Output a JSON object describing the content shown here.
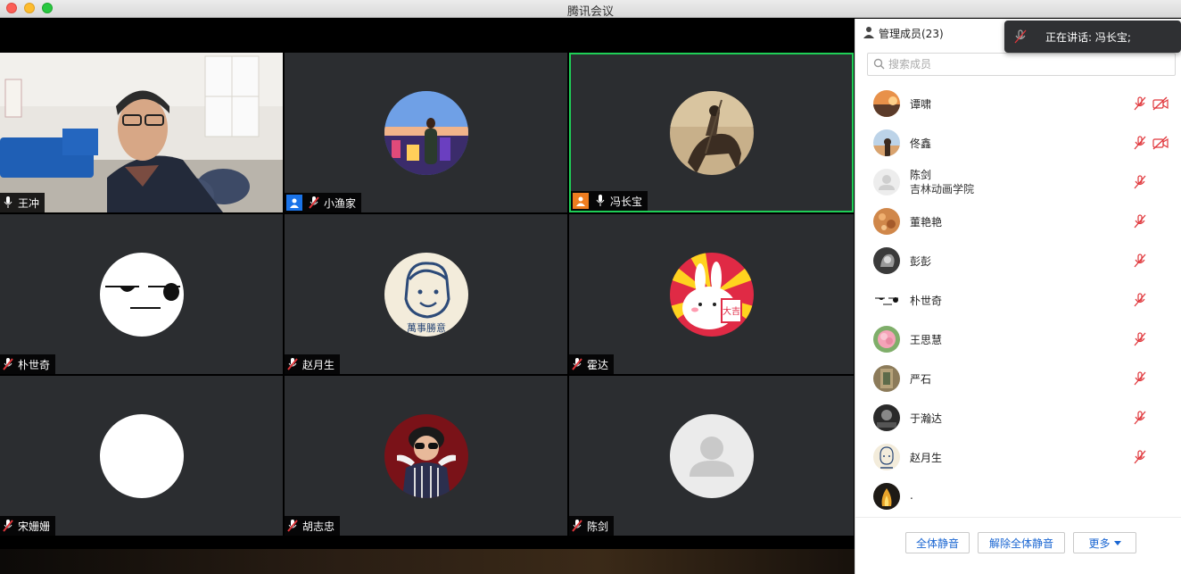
{
  "window": {
    "title": "腾讯会议"
  },
  "tiles": [
    {
      "name": "王冲",
      "mic": "on",
      "host": null,
      "active": false,
      "avatar": "video-feed"
    },
    {
      "name": "小渔家",
      "mic": "muted",
      "host": "blue",
      "active": false,
      "avatar": "city-night-photo"
    },
    {
      "name": "冯长宝",
      "mic": "on",
      "host": "orange",
      "active": true,
      "avatar": "knight-on-horse"
    },
    {
      "name": "朴世奇",
      "mic": "muted",
      "host": null,
      "active": false,
      "avatar": "meh-face"
    },
    {
      "name": "赵月生",
      "mic": "muted",
      "host": null,
      "active": false,
      "avatar": "smiling-boy"
    },
    {
      "name": "霍达",
      "mic": "muted",
      "host": null,
      "active": false,
      "avatar": "bunny"
    },
    {
      "name": "宋姗姗",
      "mic": "muted",
      "host": null,
      "active": false,
      "avatar": "blank-white"
    },
    {
      "name": "胡志忠",
      "mic": "muted",
      "host": null,
      "active": false,
      "avatar": "child-sunglasses"
    },
    {
      "name": "陈剑",
      "mic": "muted",
      "host": null,
      "active": false,
      "avatar": "default-person"
    }
  ],
  "boy_badge_text": "萬事勝意",
  "bunny_badge_text": "大吉",
  "panel": {
    "header_label": "管理成员(23)",
    "search_placeholder": "搜索成员",
    "members": [
      {
        "name": "谭啸",
        "sub": "",
        "avatar": "sunset-photo",
        "mic": "muted",
        "camera": "off"
      },
      {
        "name": "佟鑫",
        "sub": "",
        "avatar": "sky-photo",
        "mic": "muted",
        "camera": "off"
      },
      {
        "name": "陈剑",
        "sub": "吉林动画学院",
        "avatar": "default-person",
        "mic": "muted",
        "camera": null
      },
      {
        "name": "董艳艳",
        "sub": "",
        "avatar": "orange-texture",
        "mic": "muted",
        "camera": null
      },
      {
        "name": "彭彭",
        "sub": "",
        "avatar": "dark-portrait",
        "mic": "muted",
        "camera": null
      },
      {
        "name": "朴世奇",
        "sub": "",
        "avatar": "meh-face",
        "mic": "muted",
        "camera": null
      },
      {
        "name": "王思慧",
        "sub": "",
        "avatar": "pink-flower",
        "mic": "muted",
        "camera": null
      },
      {
        "name": "严石",
        "sub": "",
        "avatar": "painting",
        "mic": "muted",
        "camera": null
      },
      {
        "name": "于瀚达",
        "sub": "",
        "avatar": "bw-photo",
        "mic": "muted",
        "camera": null
      },
      {
        "name": "赵月生",
        "sub": "",
        "avatar": "smiling-boy",
        "mic": "muted",
        "camera": null
      },
      {
        "name": ".",
        "sub": "",
        "avatar": "fire-photo",
        "mic": null,
        "camera": null
      }
    ],
    "footer_buttons": {
      "mute_all": "全体静音",
      "unmute_all": "解除全体静音",
      "more": "更多"
    }
  },
  "toast": {
    "text": "正在讲话: 冯长宝;"
  },
  "colors": {
    "active_border": "#1fcf57",
    "mute_red": "#e0363b",
    "link_blue": "#1a66d2"
  }
}
